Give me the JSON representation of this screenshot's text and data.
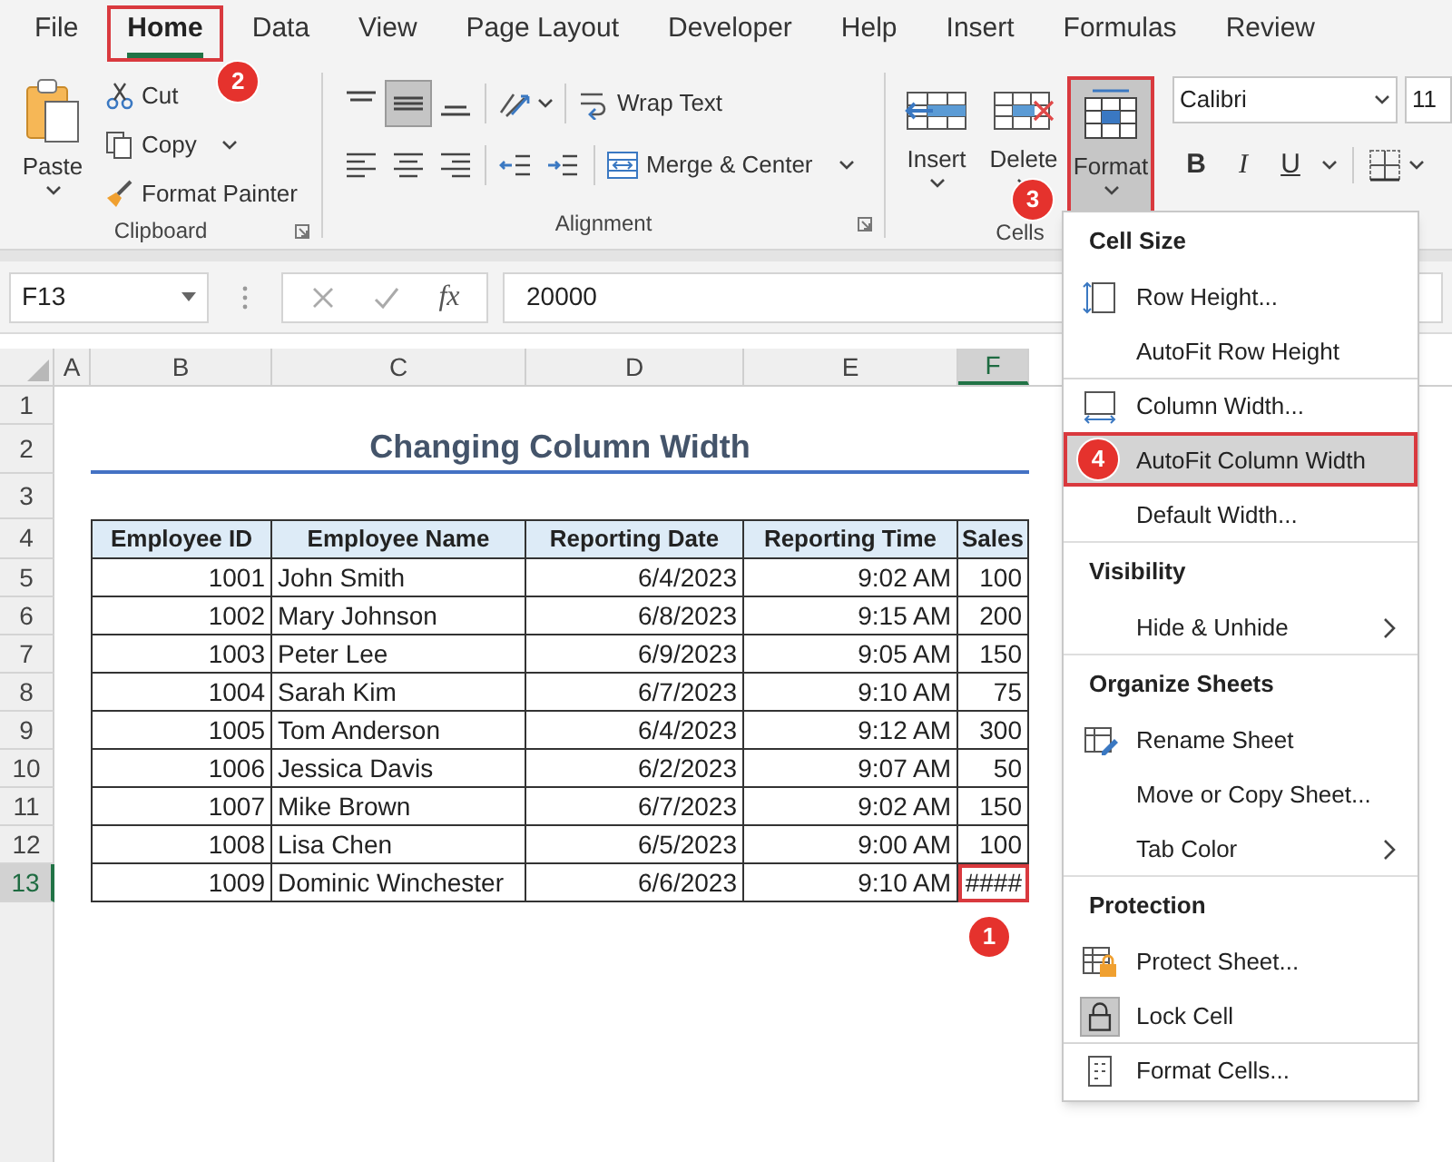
{
  "tabs": [
    {
      "label": "File",
      "selected": false
    },
    {
      "label": "Home",
      "selected": true,
      "step": "2"
    },
    {
      "label": "Data",
      "selected": false
    },
    {
      "label": "View",
      "selected": false
    },
    {
      "label": "Page Layout",
      "selected": false
    },
    {
      "label": "Developer",
      "selected": false
    },
    {
      "label": "Help",
      "selected": false
    },
    {
      "label": "Insert",
      "selected": false
    },
    {
      "label": "Formulas",
      "selected": false
    },
    {
      "label": "Review",
      "selected": false
    }
  ],
  "ribbon": {
    "clipboard": {
      "label": "Clipboard",
      "paste": "Paste",
      "commands": [
        {
          "label": "Cut",
          "kind": "button"
        },
        {
          "label": "Copy",
          "kind": "dropdown"
        },
        {
          "label": "Format Painter",
          "kind": "button"
        }
      ]
    },
    "alignment": {
      "label": "Alignment",
      "vertical_align": [
        {
          "selected": false
        },
        {
          "selected": true
        },
        {
          "selected": false
        }
      ],
      "wrap_text": "Wrap Text",
      "merge": "Merge & Center"
    },
    "cells": {
      "label": "Cells",
      "buttons": [
        {
          "label": "Insert",
          "selected": false
        },
        {
          "label": "Delete",
          "selected": false
        },
        {
          "label": "Format",
          "selected": true,
          "step": "3"
        }
      ]
    },
    "font": {
      "name": "Calibri",
      "size": "11",
      "styles": [
        "B",
        "I",
        "U"
      ]
    }
  },
  "formula_bar": {
    "name_box": "F13",
    "function_label": "fx",
    "value": "20000"
  },
  "sheet": {
    "columns": [
      {
        "label": "A",
        "selected": false
      },
      {
        "label": "B",
        "selected": false
      },
      {
        "label": "C",
        "selected": false
      },
      {
        "label": "D",
        "selected": false
      },
      {
        "label": "E",
        "selected": false
      },
      {
        "label": "F",
        "selected": true
      }
    ],
    "rows": [
      {
        "label": "1",
        "selected": false
      },
      {
        "label": "2",
        "selected": false
      },
      {
        "label": "3",
        "selected": false
      },
      {
        "label": "4",
        "selected": false
      },
      {
        "label": "5",
        "selected": false
      },
      {
        "label": "6",
        "selected": false
      },
      {
        "label": "7",
        "selected": false
      },
      {
        "label": "8",
        "selected": false
      },
      {
        "label": "9",
        "selected": false
      },
      {
        "label": "10",
        "selected": false
      },
      {
        "label": "11",
        "selected": false
      },
      {
        "label": "12",
        "selected": false
      },
      {
        "label": "13",
        "selected": true
      }
    ],
    "title": "Changing Column Width",
    "table": {
      "headers": [
        "Employee ID",
        "Employee Name",
        "Reporting Date",
        "Reporting Time",
        "Sales"
      ],
      "rows": [
        {
          "cells": [
            "1001",
            "John Smith",
            "6/4/2023",
            "9:02 AM",
            "100"
          ],
          "selected": false
        },
        {
          "cells": [
            "1002",
            "Mary Johnson",
            "6/8/2023",
            "9:15 AM",
            "200"
          ],
          "selected": false
        },
        {
          "cells": [
            "1003",
            "Peter Lee",
            "6/9/2023",
            "9:05 AM",
            "150"
          ],
          "selected": false
        },
        {
          "cells": [
            "1004",
            "Sarah Kim",
            "6/7/2023",
            "9:10 AM",
            "75"
          ],
          "selected": false
        },
        {
          "cells": [
            "1005",
            "Tom Anderson",
            "6/4/2023",
            "9:12 AM",
            "300"
          ],
          "selected": false
        },
        {
          "cells": [
            "1006",
            "Jessica Davis",
            "6/2/2023",
            "9:07 AM",
            "50"
          ],
          "selected": false
        },
        {
          "cells": [
            "1007",
            "Mike Brown",
            "6/7/2023",
            "9:02 AM",
            "150"
          ],
          "selected": false
        },
        {
          "cells": [
            "1008",
            "Lisa Chen",
            "6/5/2023",
            "9:00 AM",
            "100"
          ],
          "selected": false
        },
        {
          "cells": [
            "1009",
            "Dominic Winchester",
            "6/6/2023",
            "9:10 AM",
            "####"
          ],
          "selected": true,
          "step": "1"
        }
      ]
    }
  },
  "menu": {
    "sections": [
      {
        "title": "Cell Size",
        "items": [
          {
            "label": "Row Height...",
            "kind": "command",
            "checked": false,
            "selected": false,
            "divider_before": false
          },
          {
            "label": "AutoFit Row Height",
            "kind": "command",
            "checked": false,
            "selected": false,
            "divider_before": false
          },
          {
            "label": "Column Width...",
            "kind": "command",
            "checked": false,
            "selected": false,
            "divider_before": true
          },
          {
            "label": "AutoFit Column Width",
            "kind": "command",
            "checked": false,
            "selected": true,
            "divider_before": false,
            "step": "4"
          },
          {
            "label": "Default Width...",
            "kind": "command",
            "checked": false,
            "selected": false,
            "divider_before": false
          }
        ]
      },
      {
        "title": "Visibility",
        "items": [
          {
            "label": "Hide & Unhide",
            "kind": "submenu",
            "checked": false,
            "selected": false,
            "divider_before": false
          }
        ]
      },
      {
        "title": "Organize Sheets",
        "items": [
          {
            "label": "Rename Sheet",
            "kind": "command",
            "checked": false,
            "selected": false,
            "divider_before": false
          },
          {
            "label": "Move or Copy Sheet...",
            "kind": "command",
            "checked": false,
            "selected": false,
            "divider_before": false
          },
          {
            "label": "Tab Color",
            "kind": "submenu",
            "checked": false,
            "selected": false,
            "divider_before": false
          }
        ]
      },
      {
        "title": "Protection",
        "items": [
          {
            "label": "Protect Sheet...",
            "kind": "command",
            "checked": false,
            "selected": false,
            "divider_before": false
          },
          {
            "label": "Lock Cell",
            "kind": "command",
            "checked": true,
            "selected": false,
            "divider_before": false
          },
          {
            "label": "Format Cells...",
            "kind": "command",
            "checked": false,
            "selected": false,
            "divider_before": true
          }
        ]
      }
    ]
  }
}
